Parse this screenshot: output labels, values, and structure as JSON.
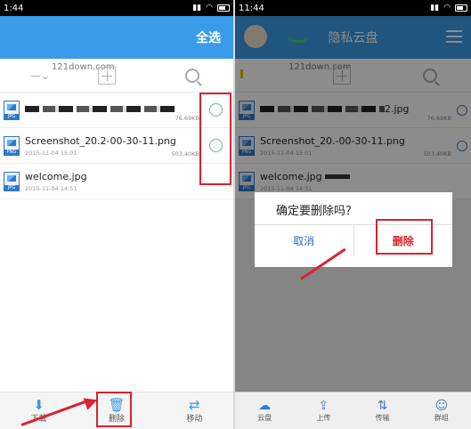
{
  "left": {
    "status": {
      "time": "1:44"
    },
    "header": {
      "select_all": "全选"
    },
    "watermark": "121down.com",
    "files": [
      {
        "name": "",
        "type": "JPG",
        "size": "76.69KB",
        "date": ""
      },
      {
        "name": "Screenshot_20.2-00-30-11.png",
        "type": "PNG",
        "size": "503.40KB",
        "date": "2015-11-04 15:01"
      },
      {
        "name": "welcome.jpg",
        "type": "JPG",
        "size": "",
        "date": "2015-11-04 14:51"
      }
    ],
    "bottom": [
      {
        "label": "下载",
        "icon": "download-icon"
      },
      {
        "label": "删除",
        "icon": "trash-icon"
      },
      {
        "label": "移动",
        "icon": "move-icon"
      }
    ]
  },
  "right": {
    "status": {
      "time": "11:44"
    },
    "header": {
      "title": "隐私云盘"
    },
    "watermark": "121down.com",
    "files": [
      {
        "name": "2.jpg",
        "type": "JPG",
        "size": "76.69KB",
        "date": ""
      },
      {
        "name": "Screenshot_20.-00-30-11.png",
        "type": "PNG",
        "size": "503.40KB",
        "date": "2015-11-04 15:01"
      },
      {
        "name": "welcome.jpg",
        "type": "JPG",
        "size": "",
        "date": "2015-11-04 14:51"
      }
    ],
    "dialog": {
      "message": "确定要删除吗？",
      "cancel": "取消",
      "confirm": "删除"
    },
    "bottom": [
      {
        "label": "云盘",
        "icon": "cloud-icon"
      },
      {
        "label": "上传",
        "icon": "upload-icon"
      },
      {
        "label": "传输",
        "icon": "transfer-icon"
      },
      {
        "label": "群组",
        "icon": "group-icon"
      }
    ]
  },
  "colors": {
    "accent": "#3a9be8",
    "highlight": "#d9232e",
    "check": "#5cb89c"
  }
}
